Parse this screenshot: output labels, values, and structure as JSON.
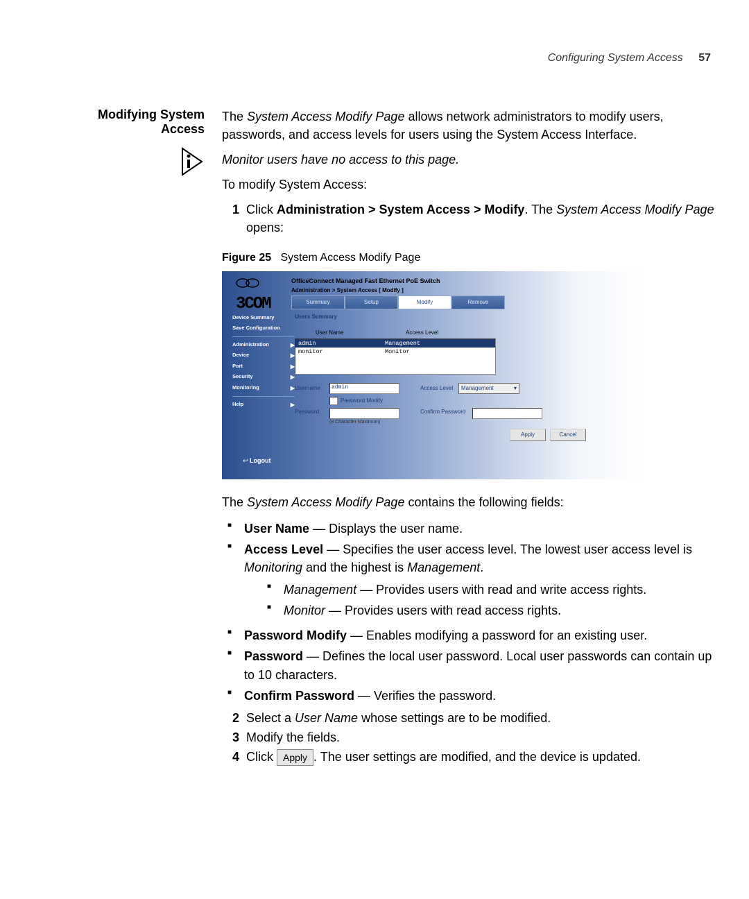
{
  "header": {
    "running": "Configuring System Access",
    "page": "57"
  },
  "section_title_l1": "Modifying System",
  "section_title_l2": "Access",
  "intro_plain1": "The ",
  "intro_ital": "System Access Modify Page",
  "intro_plain2": " allows network administrators to modify users, passwords, and access levels for users using the System Access Interface.",
  "note": "Monitor users have no access to this page.",
  "lead": "To modify System Access:",
  "step1_pre": "Click ",
  "step1_bold": "Administration > System Access > Modify",
  "step1_mid": ". The ",
  "step1_ital": "System Access Modify Page",
  "step1_post": " opens:",
  "fig_label": "Figure 25",
  "fig_caption": "System Access Modify Page",
  "shot": {
    "brand": "3COM",
    "title": "OfficeConnect Managed Fast Ethernet PoE Switch",
    "breadcrumb": "Administration > System Access [ Modify ]",
    "tabs": [
      "Summary",
      "Setup",
      "Modify",
      "Remove"
    ],
    "nav": [
      "Device Summary",
      "Save Configuration",
      "Administration",
      "Device",
      "Port",
      "Security",
      "Monitoring",
      "Help"
    ],
    "panel_title": "Users Summary",
    "cols": [
      "User Name",
      "Access Level"
    ],
    "rows": [
      {
        "user": "admin",
        "level": "Management",
        "sel": true
      },
      {
        "user": "monitor",
        "level": "Monitor",
        "sel": false
      }
    ],
    "form": {
      "username_l": "Username",
      "username_v": "admin",
      "al_l": "Access Level",
      "al_v": "Management",
      "pm_l": "Password Modify",
      "pw_l": "Password",
      "pw_hint": "(8 Character Maximum)",
      "cpw_l": "Confirm Password",
      "apply": "Apply",
      "cancel": "Cancel"
    },
    "logout": "Logout"
  },
  "after_fig_pre": "The ",
  "after_fig_ital": "System Access Modify Page",
  "after_fig_post": " contains the following fields:",
  "bullets": {
    "b1_bold": "User Name",
    "b1_rest": " — Displays the user name.",
    "b2_bold": "Access Level",
    "b2_rest": " — Specifies the user access level. The lowest user access level is ",
    "b2_i1": "Monitoring",
    "b2_mid": " and the highest is ",
    "b2_i2": "Management",
    "b2_end": ".",
    "s1_i": "Management",
    "s1_rest": " — Provides users with read and write access rights.",
    "s2_i": "Monitor",
    "s2_rest": " — Provides users with read access rights.",
    "b3_bold": "Password Modify",
    "b3_rest": " — Enables modifying a password for an existing user.",
    "b4_bold": "Password",
    "b4_rest": " — Defines the local user password. Local user passwords can contain up to 10 characters.",
    "b5_bold": "Confirm Password",
    "b5_rest": " — Verifies the password."
  },
  "step2_pre": "Select a ",
  "step2_ital": "User Name",
  "step2_post": " whose settings are to be modified.",
  "step3": "Modify the fields.",
  "step4_pre": "Click ",
  "step4_btn": "Apply",
  "step4_post": ". The user settings are modified, and the device is updated."
}
